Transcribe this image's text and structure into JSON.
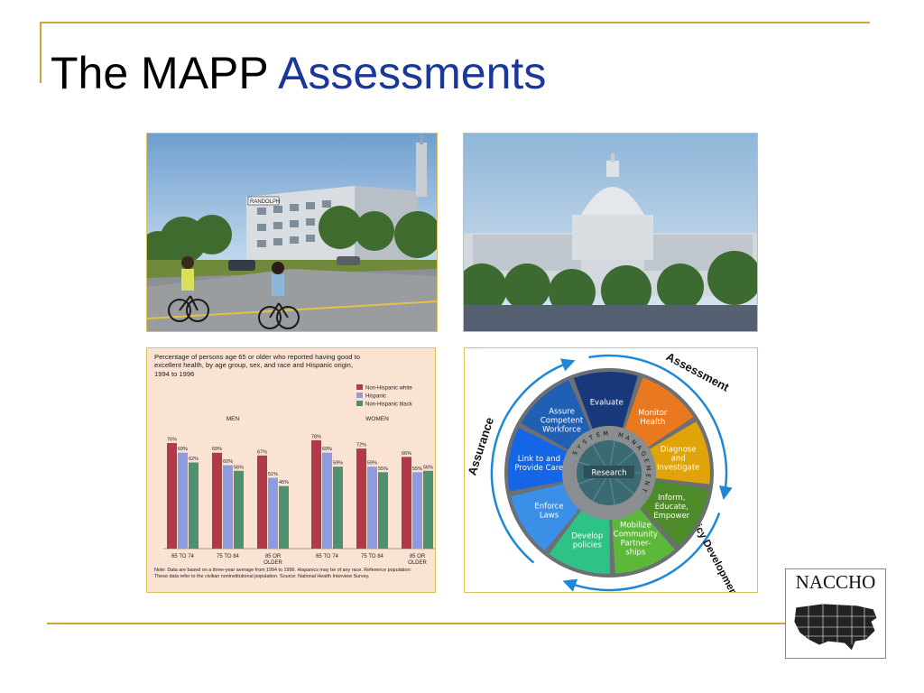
{
  "slide": {
    "title_part1": "The MAPP",
    "title_part2": "Assessments"
  },
  "photos": [
    {
      "description": "two children riding bicycles near office buildings",
      "sign_text": "RANDOLPH"
    },
    {
      "description": "U.S. Capitol building"
    }
  ],
  "chart_data": {
    "type": "bar",
    "title": "Percentage of persons age 65 or older who reported having good to excellent health, by age group, sex, and race and Hispanic origin, 1994 to 1996",
    "groups": [
      "MEN",
      "WOMEN"
    ],
    "categories": [
      "65 TO 74",
      "75 TO 84",
      "85 OR OLDER"
    ],
    "legend": [
      "Non-Hispanic white",
      "Hispanic",
      "Non-Hispanic black"
    ],
    "legend_position": "top-right",
    "colors": [
      "#b23a48",
      "#8f9be0",
      "#4f9070"
    ],
    "ylim": [
      0,
      100
    ],
    "series": [
      {
        "name": "Non-Hispanic white",
        "values": [
          76,
          69,
          67,
          78,
          72,
          66
        ]
      },
      {
        "name": "Hispanic",
        "values": [
          69,
          60,
          51,
          69,
          59,
          55
        ]
      },
      {
        "name": "Non-Hispanic black",
        "values": [
          62,
          56,
          45,
          59,
          55,
          56
        ]
      }
    ],
    "x_tick_labels": [
      "65 TO 74",
      "75 TO 84",
      "85 OR OLDER",
      "65 TO 74",
      "75 TO 84",
      "85 OR OLDER"
    ],
    "note": "Note: Data are based on a three-year average from 1994 to 1996. Hispanics may be of any race. Reference population: These data refer to the civilian noninstitutional population. Source: National Health Interview Survey."
  },
  "wheel": {
    "outer_labels": [
      "Assessment",
      "Policy Development",
      "Assurance"
    ],
    "ring_label": "SYSTEM MANAGEMENT",
    "center_label": "Research",
    "segments": [
      {
        "label": [
          "Monitor",
          "Health"
        ],
        "color": "#e9781e"
      },
      {
        "label": [
          "Diagnose",
          "and",
          "Investigate"
        ],
        "color": "#e0a40a"
      },
      {
        "label": [
          "Inform,",
          "Educate,",
          "Empower"
        ],
        "color": "#4c8a2a"
      },
      {
        "label": [
          "Mobilize",
          "Community",
          "Partner-",
          "ships"
        ],
        "color": "#5cb838"
      },
      {
        "label": [
          "Develop",
          "policies"
        ],
        "color": "#2fc286"
      },
      {
        "label": [
          "Enforce",
          "Laws"
        ],
        "color": "#3b8fe6"
      },
      {
        "label": [
          "Link to and",
          "Provide Care"
        ],
        "color": "#1466e6"
      },
      {
        "label": [
          "Assure",
          "Competent",
          "Workforce"
        ],
        "color": "#1f5fb4"
      },
      {
        "label": [
          "Evaluate"
        ],
        "color": "#17397c"
      }
    ]
  },
  "logo": {
    "text": "NACCHO"
  }
}
